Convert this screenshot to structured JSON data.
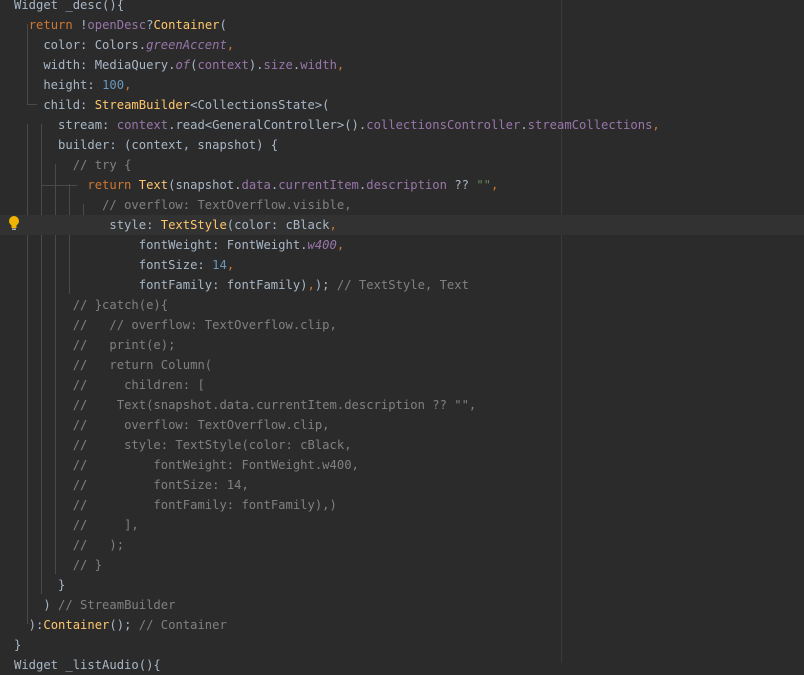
{
  "editor": {
    "theme_colors": {
      "background": "#2b2b2b",
      "current_line": "#323232",
      "keyword": "#cc7832",
      "class": "#ffc66d",
      "field": "#9876aa",
      "number": "#6897bb",
      "string": "#6a8759",
      "comment": "#808080",
      "text": "#a9b7c6"
    },
    "gutter_icon": "lightbulb-icon",
    "current_line_index": 11,
    "lines": [
      [
        [
          "plain",
          "Widget _desc(){"
        ]
      ],
      [
        [
          "plain",
          "  "
        ],
        [
          "kw",
          "return "
        ],
        [
          "plain",
          "!"
        ],
        [
          "fld",
          "openDesc"
        ],
        [
          "plain",
          "?"
        ],
        [
          "cls",
          "Container"
        ],
        [
          "plain",
          "("
        ]
      ],
      [
        [
          "plain",
          "    color: Colors."
        ],
        [
          "fldi",
          "greenAccent"
        ],
        [
          "kw",
          ","
        ]
      ],
      [
        [
          "plain",
          "    width: MediaQuery."
        ],
        [
          "fldi",
          "of"
        ],
        [
          "plain",
          "("
        ],
        [
          "fld",
          "context"
        ],
        [
          "plain",
          ")."
        ],
        [
          "fld",
          "size"
        ],
        [
          "plain",
          "."
        ],
        [
          "fld",
          "width"
        ],
        [
          "kw",
          ","
        ]
      ],
      [
        [
          "plain",
          "    height: "
        ],
        [
          "num",
          "100"
        ],
        [
          "kw",
          ","
        ]
      ],
      [
        [
          "plain",
          "    child: "
        ],
        [
          "cls",
          "StreamBuilder"
        ],
        [
          "plain",
          "<CollectionsState>("
        ]
      ],
      [
        [
          "plain",
          "      stream: "
        ],
        [
          "fld",
          "context"
        ],
        [
          "plain",
          ".read<GeneralController>()."
        ],
        [
          "fld",
          "collectionsController"
        ],
        [
          "plain",
          "."
        ],
        [
          "fld",
          "streamCollections"
        ],
        [
          "kw",
          ","
        ]
      ],
      [
        [
          "plain",
          "      builder: (context, snapshot) {"
        ]
      ],
      [
        [
          "plain",
          "        "
        ],
        [
          "com",
          "// try {"
        ]
      ],
      [
        [
          "plain",
          "          "
        ],
        [
          "kw",
          "return "
        ],
        [
          "cls",
          "Text"
        ],
        [
          "plain",
          "(snapshot."
        ],
        [
          "fld",
          "data"
        ],
        [
          "plain",
          "."
        ],
        [
          "fld",
          "currentItem"
        ],
        [
          "plain",
          "."
        ],
        [
          "fld",
          "description "
        ],
        [
          "plain",
          "?? "
        ],
        [
          "str",
          "\"\""
        ],
        [
          "kw",
          ","
        ]
      ],
      [
        [
          "plain",
          "            "
        ],
        [
          "com",
          "// overflow: TextOverflow.visible,"
        ]
      ],
      [
        [
          "plain",
          "             style: "
        ],
        [
          "cls",
          "TextStyle"
        ],
        [
          "plain",
          "(color: cBlack"
        ],
        [
          "kw",
          ","
        ]
      ],
      [
        [
          "plain",
          "                 fontWeight: FontWeight."
        ],
        [
          "fldi",
          "w400"
        ],
        [
          "kw",
          ","
        ]
      ],
      [
        [
          "plain",
          "                 fontSize: "
        ],
        [
          "num",
          "14"
        ],
        [
          "kw",
          ","
        ]
      ],
      [
        [
          "plain",
          "                 fontFamily: fontFamily)"
        ],
        [
          "kw",
          ","
        ],
        [
          "plain",
          ");"
        ],
        [
          "com",
          " // TextStyle, Text"
        ]
      ],
      [
        [
          "plain",
          "        "
        ],
        [
          "com",
          "// }catch(e){"
        ]
      ],
      [
        [
          "plain",
          "        "
        ],
        [
          "com",
          "//   // overflow: TextOverflow.clip,"
        ]
      ],
      [
        [
          "plain",
          "        "
        ],
        [
          "com",
          "//   print(e);"
        ]
      ],
      [
        [
          "plain",
          "        "
        ],
        [
          "com",
          "//   return Column("
        ]
      ],
      [
        [
          "plain",
          "        "
        ],
        [
          "com",
          "//     children: ["
        ]
      ],
      [
        [
          "plain",
          "        "
        ],
        [
          "com",
          "//    Text(snapshot.data.currentItem.description ?? \"\","
        ]
      ],
      [
        [
          "plain",
          "        "
        ],
        [
          "com",
          "//     overflow: TextOverflow.clip,"
        ]
      ],
      [
        [
          "plain",
          "        "
        ],
        [
          "com",
          "//     style: TextStyle(color: cBlack,"
        ]
      ],
      [
        [
          "plain",
          "        "
        ],
        [
          "com",
          "//         fontWeight: FontWeight.w400,"
        ]
      ],
      [
        [
          "plain",
          "        "
        ],
        [
          "com",
          "//         fontSize: 14,"
        ]
      ],
      [
        [
          "plain",
          "        "
        ],
        [
          "com",
          "//         fontFamily: fontFamily),)"
        ]
      ],
      [
        [
          "plain",
          "        "
        ],
        [
          "com",
          "//     ],"
        ]
      ],
      [
        [
          "plain",
          "        "
        ],
        [
          "com",
          "//   );"
        ]
      ],
      [
        [
          "plain",
          "        "
        ],
        [
          "com",
          "// }"
        ]
      ],
      [
        [
          "plain",
          "      }"
        ]
      ],
      [
        [
          "plain",
          "    ) "
        ],
        [
          "com",
          "// StreamBuilder"
        ]
      ],
      [
        [
          "plain",
          "  ):"
        ],
        [
          "cls",
          "Container"
        ],
        [
          "plain",
          "(); "
        ],
        [
          "com",
          "// Container"
        ]
      ],
      [
        [
          "plain",
          "}"
        ]
      ],
      [
        [
          "plain",
          "Widget _listAudio(){"
        ]
      ]
    ]
  }
}
